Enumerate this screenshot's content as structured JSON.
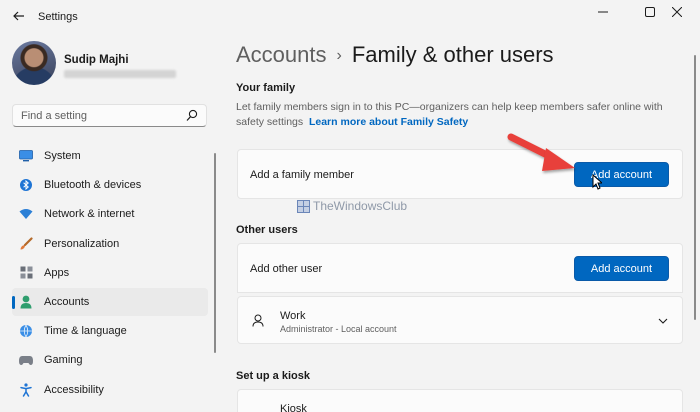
{
  "window": {
    "title": "Settings",
    "back_icon": "arrow-left-icon",
    "controls": [
      "minimize-icon",
      "maximize-icon",
      "close-icon"
    ]
  },
  "profile": {
    "name": "Sudip Majhi"
  },
  "search": {
    "placeholder": "Find a setting",
    "icon": "search-icon"
  },
  "sidebar": {
    "items": [
      {
        "label": "System",
        "icon": "monitor-icon",
        "active": false
      },
      {
        "label": "Bluetooth & devices",
        "icon": "bluetooth-icon",
        "active": false
      },
      {
        "label": "Network & internet",
        "icon": "wifi-icon",
        "active": false
      },
      {
        "label": "Personalization",
        "icon": "brush-icon",
        "active": false
      },
      {
        "label": "Apps",
        "icon": "apps-icon",
        "active": false
      },
      {
        "label": "Accounts",
        "icon": "person-icon",
        "active": true
      },
      {
        "label": "Time & language",
        "icon": "globe-icon",
        "active": false
      },
      {
        "label": "Gaming",
        "icon": "gamepad-icon",
        "active": false
      },
      {
        "label": "Accessibility",
        "icon": "accessibility-icon",
        "active": false
      }
    ]
  },
  "breadcrumb": {
    "parent": "Accounts",
    "separator": "›",
    "current": "Family & other users"
  },
  "your_family": {
    "title": "Your family",
    "description": "Let family members sign in to this PC—organizers can help keep members safer online with safety settings",
    "link": "Learn more about Family Safety",
    "card_label": "Add a family member",
    "button": "Add account"
  },
  "other_users": {
    "title": "Other users",
    "card_label": "Add other user",
    "button": "Add account",
    "accounts": [
      {
        "name": "Work",
        "detail": "Administrator - Local account",
        "icon": "person-outline-icon",
        "expand_icon": "chevron-down-icon"
      }
    ]
  },
  "kiosk": {
    "title": "Set up a kiosk",
    "item_label": "Kiosk"
  },
  "watermark": {
    "text": "TheWindowsClub"
  },
  "colors": {
    "accent": "#0067c0",
    "background": "#f3f3f3",
    "card": "#fbfbfb",
    "annotation_arrow": "#e8413a"
  }
}
